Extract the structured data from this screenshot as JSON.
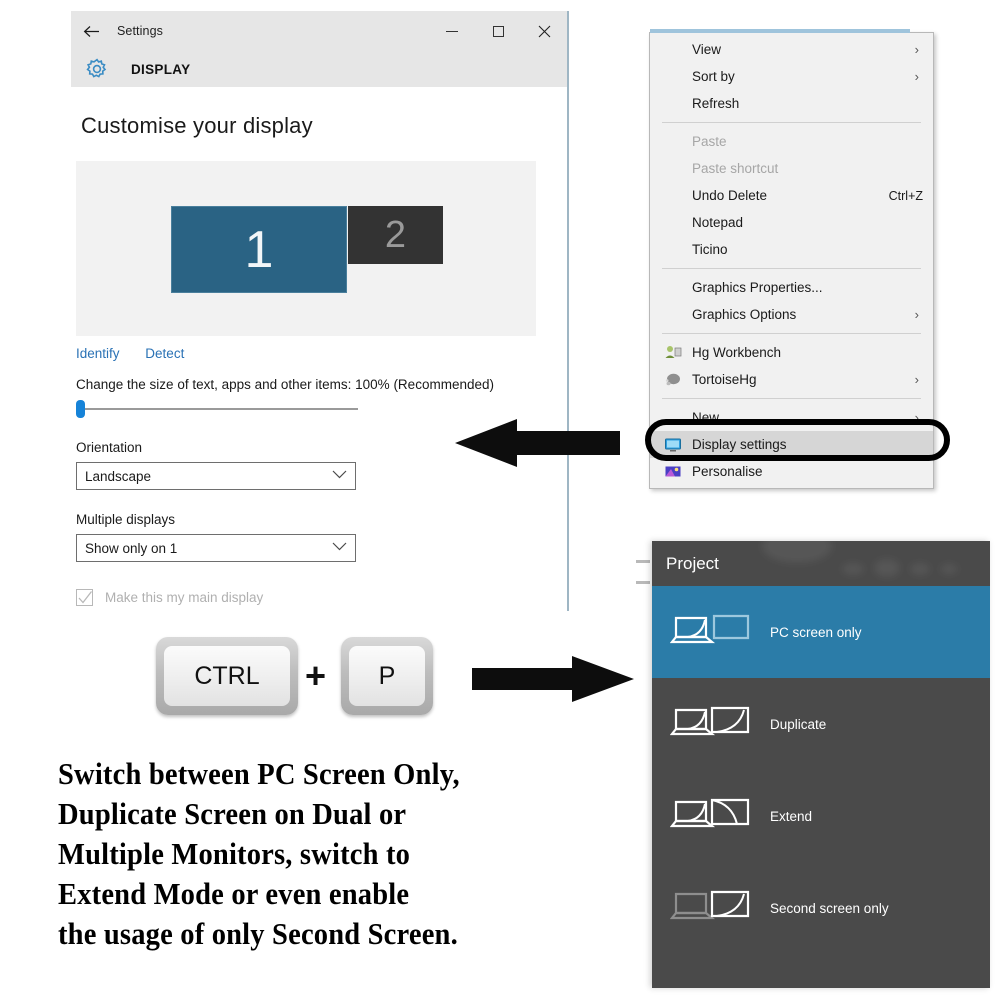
{
  "settings_window": {
    "title": "Settings",
    "back_icon": "back-arrow-icon",
    "window_controls": {
      "minimize": "–",
      "maximize": "□",
      "close": "✕"
    },
    "header_icon": "gear-icon",
    "header_label": "DISPLAY",
    "page_title": "Customise your display",
    "monitors": [
      {
        "number": "1",
        "state": "selected"
      },
      {
        "number": "2",
        "state": "inactive"
      }
    ],
    "links": [
      "Identify",
      "Detect"
    ],
    "scale_label": "Change the size of text, apps and other items: 100% (Recommended)",
    "scale_value": "100%",
    "orientation": {
      "label": "Orientation",
      "value": "Landscape"
    },
    "multiple_displays": {
      "label": "Multiple displays",
      "value": "Show only on 1"
    },
    "main_display_checkbox": {
      "label": "Make this my main display",
      "checked": true,
      "enabled": false
    },
    "accent_color": "#2a6384",
    "slider_color": "#1683d8"
  },
  "context_menu": {
    "items": [
      {
        "label": "View",
        "submenu": true,
        "disabled": false,
        "icon": null,
        "accel": ""
      },
      {
        "label": "Sort by",
        "submenu": true,
        "disabled": false,
        "icon": null,
        "accel": ""
      },
      {
        "label": "Refresh",
        "submenu": false,
        "disabled": false,
        "icon": null,
        "accel": ""
      },
      {
        "separator": true
      },
      {
        "label": "Paste",
        "submenu": false,
        "disabled": true,
        "icon": null,
        "accel": ""
      },
      {
        "label": "Paste shortcut",
        "submenu": false,
        "disabled": true,
        "icon": null,
        "accel": ""
      },
      {
        "label": "Undo Delete",
        "submenu": false,
        "disabled": false,
        "icon": null,
        "accel": "Ctrl+Z"
      },
      {
        "label": "Notepad",
        "submenu": false,
        "disabled": false,
        "icon": null,
        "accel": ""
      },
      {
        "label": "Ticino",
        "submenu": false,
        "disabled": false,
        "icon": null,
        "accel": ""
      },
      {
        "separator": true
      },
      {
        "label": "Graphics Properties...",
        "submenu": false,
        "disabled": false,
        "icon": null,
        "accel": ""
      },
      {
        "label": "Graphics Options",
        "submenu": true,
        "disabled": false,
        "icon": null,
        "accel": ""
      },
      {
        "separator": true
      },
      {
        "label": "Hg Workbench",
        "submenu": false,
        "disabled": false,
        "icon": "hg-workbench-icon",
        "accel": ""
      },
      {
        "label": "TortoiseHg",
        "submenu": true,
        "disabled": false,
        "icon": "tortoisehg-icon",
        "accel": ""
      },
      {
        "separator": true
      },
      {
        "label": "New",
        "submenu": true,
        "disabled": false,
        "icon": null,
        "accel": ""
      },
      {
        "label": "Display settings",
        "submenu": false,
        "disabled": false,
        "icon": "display-settings-icon",
        "accel": "",
        "selected": true
      },
      {
        "label": "Personalise",
        "submenu": false,
        "disabled": false,
        "icon": "personalise-icon",
        "accel": ""
      }
    ],
    "highlight_target": "Display settings"
  },
  "project_panel": {
    "title": "Project",
    "options": [
      {
        "label": "PC screen only",
        "icon": "pc-screen-only-icon",
        "active": true
      },
      {
        "label": "Duplicate",
        "icon": "duplicate-icon",
        "active": false
      },
      {
        "label": "Extend",
        "icon": "extend-icon",
        "active": false
      },
      {
        "label": "Second screen only",
        "icon": "second-screen-only-icon",
        "active": false
      }
    ],
    "active_color": "#2b7ca8",
    "background_color": "#4a4a4a"
  },
  "shortcut": {
    "key1": "CTRL",
    "plus": "+",
    "key2": "P"
  },
  "arrows": {
    "left_arrow": "arrow-left-icon",
    "right_arrow": "arrow-right-icon"
  },
  "caption": {
    "line1": "Switch between PC Screen Only,",
    "line2": "Duplicate Screen on Dual or",
    "line3": "Multiple Monitors, switch to",
    "line4": "Extend Mode or even enable",
    "line5": "the usage of only Second Screen."
  }
}
